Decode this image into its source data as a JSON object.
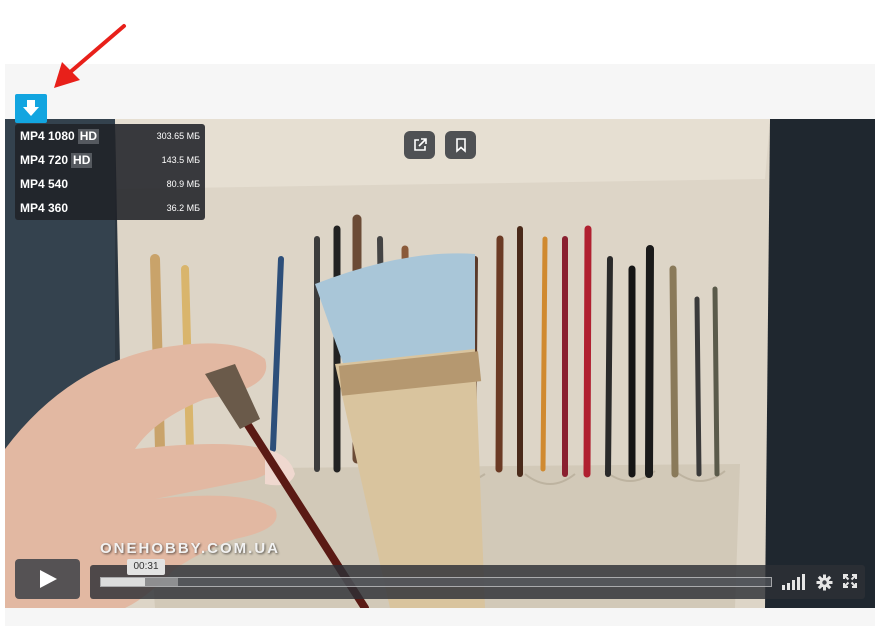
{
  "download_menu": {
    "items": [
      {
        "format": "MP4 1080",
        "hd": "HD",
        "size": "303.65 МБ"
      },
      {
        "format": "MP4 720",
        "hd": "HD",
        "size": "143.5 МБ"
      },
      {
        "format": "MP4 540",
        "hd": "",
        "size": "80.9 МБ"
      },
      {
        "format": "MP4 360",
        "hd": "",
        "size": "36.2 МБ"
      }
    ]
  },
  "player": {
    "watermark": "ONEHOBBY.COM.UA",
    "time_tooltip": "00:31",
    "progress_played": 0.065,
    "progress_buffered": 0.115
  },
  "icons": {
    "download": "download-arrow-icon",
    "share": "share-external-icon",
    "bookmark": "bookmark-icon",
    "play": "play-icon",
    "volume": "volume-bars-icon",
    "settings": "gear-icon",
    "fullscreen": "fullscreen-icon"
  },
  "colors": {
    "accent": "#12a5e0",
    "annotation_arrow": "#e8201a"
  }
}
